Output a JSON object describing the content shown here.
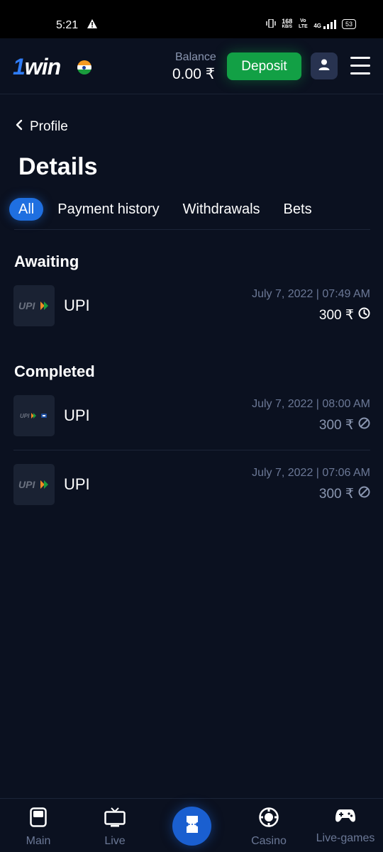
{
  "status_bar": {
    "time": "5:21",
    "net_speed": "168",
    "net_unit": "KB/S",
    "carrier": "Vo LTE",
    "signal": "4G",
    "battery": "53"
  },
  "header": {
    "logo": "1win",
    "balance_label": "Balance",
    "balance_value": "0.00 ₹",
    "deposit_label": "Deposit"
  },
  "nav": {
    "back_label": "Profile",
    "page_title": "Details"
  },
  "tabs": [
    {
      "label": "All",
      "active": true
    },
    {
      "label": "Payment history",
      "active": false
    },
    {
      "label": "Withdrawals",
      "active": false
    },
    {
      "label": "Bets",
      "active": false
    }
  ],
  "sections": {
    "awaiting": {
      "title": "Awaiting",
      "items": [
        {
          "method": "UPI",
          "date": "July 7, 2022 | 07:49 AM",
          "amount": "300 ₹",
          "status_icon": "clock-icon"
        }
      ]
    },
    "completed": {
      "title": "Completed",
      "items": [
        {
          "method": "UPI",
          "date": "July 7, 2022 | 08:00 AM",
          "amount": "300 ₹",
          "status_icon": "cancelled-icon"
        },
        {
          "method": "UPI",
          "date": "July 7, 2022 | 07:06 AM",
          "amount": "300 ₹",
          "status_icon": "cancelled-icon"
        }
      ]
    }
  },
  "bottom_nav": [
    {
      "label": "Main",
      "icon": "main-icon"
    },
    {
      "label": "Live",
      "icon": "tv-icon"
    },
    {
      "label": "",
      "icon": "bet-slip-icon"
    },
    {
      "label": "Casino",
      "icon": "casino-chip-icon"
    },
    {
      "label": "Live-games",
      "icon": "gamepad-icon"
    }
  ],
  "colors": {
    "background": "#0b1120",
    "accent_blue": "#1f6fe0",
    "deposit_green": "#12a045",
    "muted_text": "#6b7896"
  }
}
